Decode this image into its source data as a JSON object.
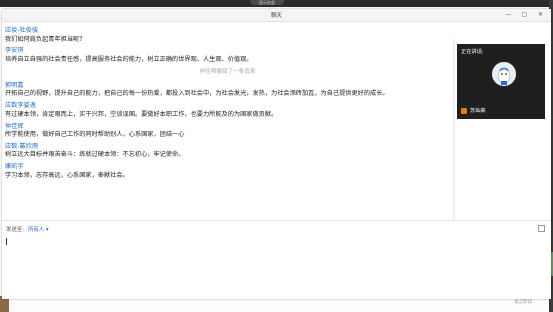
{
  "app": {
    "title": "聊天",
    "bg_pill": "显示在此"
  },
  "window_buttons": {
    "minimize": "—",
    "restore": "▢",
    "close": "✕"
  },
  "messages": [
    {
      "sender": "应俊-杜俊骏",
      "text": "我们如何肩负起青年担当呢？"
    },
    {
      "sender": "李安琪",
      "text": "培养自立自强的社会责任感，提高服务社会的能力，树立正确的世界观、人生观、价值观。"
    },
    {
      "sender": "郭明嘉",
      "text": "开拓自己的视野，提升自己的能力，把自己的每一份热爱，都投入到社会中，为社会发光，发热，为社会添砖加瓦，为自己提供更好的成长。"
    },
    {
      "sender": "应数李姿逸",
      "text": "有过硬本领，肯定艰而上，实干兴邦，空谈误国。要做好本职工作，也要力所能及的为国家做贡献。"
    },
    {
      "sender": "仲佳辉",
      "text": "所学能使用，做好自己工作的同时帮助别人，心系国家，团结一心"
    },
    {
      "sender": "应数-戴欣雨",
      "text": "树立远大目标并艰苦奋斗：练就过硬本领：不忘初心，牢记使命。"
    },
    {
      "sender": "康凯宇",
      "text": "学习本领，志存高远，心系国家，奉献社会。"
    }
  ],
  "notice": "仲佳帮撤回了一条消息",
  "speaking": {
    "label": "正在讲话:",
    "name": "苏灿高"
  },
  "compose": {
    "sendto_label": "发送至:",
    "sendto_value": "所有人 ▾",
    "input_value": "",
    "input_placeholder": ""
  },
  "background": {
    "handle_text": "✓ ↩ ☰ ▼",
    "corner_label": "发言阶段"
  },
  "colors": {
    "sender": "#2b6cc4",
    "panel": "#1f1f1f",
    "mic": "#e07a1b"
  }
}
